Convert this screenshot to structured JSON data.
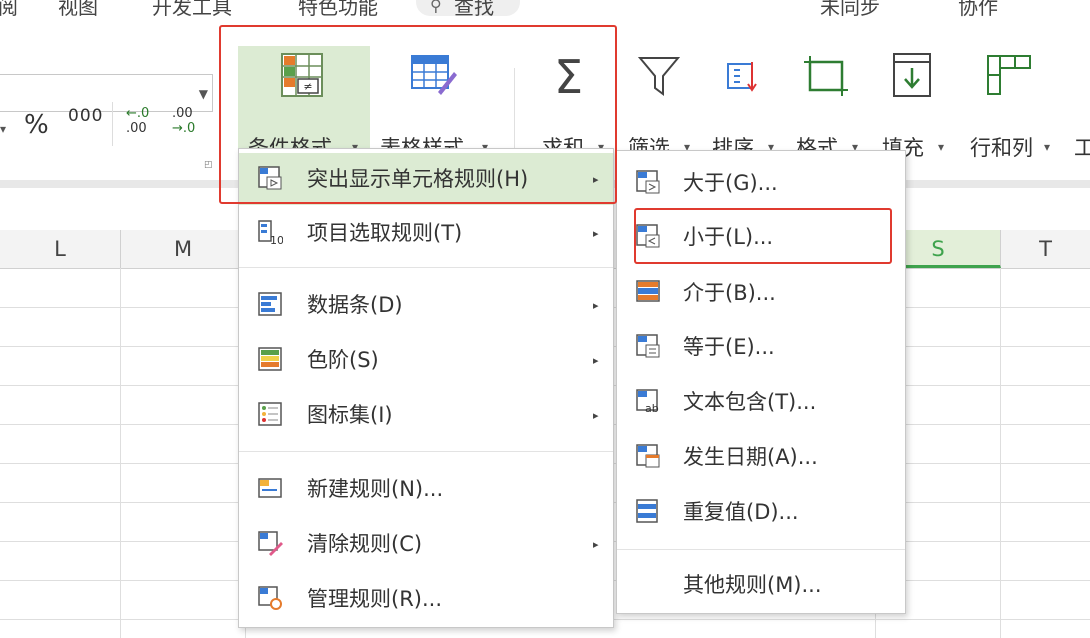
{
  "top_menu": [
    "阅",
    "视图",
    "开发工具",
    "特色功能",
    "查找",
    "未同步",
    "协作"
  ],
  "number_format": {
    "percent": "%",
    "thousands": "000",
    "inc_decimal_top": "←.0",
    "inc_decimal_bottom": ".00",
    "dec_decimal_top": ".00",
    "dec_decimal_bottom": "→.0"
  },
  "ribbon": {
    "conditional_format": "条件格式",
    "table_style": "表格样式",
    "sum": "求和",
    "filter": "筛选",
    "sort": "排序",
    "format": "格式",
    "fill": "填充",
    "rows_cols": "行和列",
    "more": "工"
  },
  "columns": [
    "L",
    "M",
    "S",
    "T"
  ],
  "cf_menu": {
    "items": [
      {
        "label": "突出显示单元格规则(H)",
        "has_submenu": true
      },
      {
        "label": "项目选取规则(T)",
        "has_submenu": true
      },
      {
        "label": "数据条(D)",
        "has_submenu": true
      },
      {
        "label": "色阶(S)",
        "has_submenu": true
      },
      {
        "label": "图标集(I)",
        "has_submenu": true
      },
      {
        "label": "新建规则(N)...",
        "has_submenu": false
      },
      {
        "label": "清除规则(C)",
        "has_submenu": true
      },
      {
        "label": "管理规则(R)...",
        "has_submenu": false
      }
    ]
  },
  "highlight_submenu": {
    "items": [
      {
        "label": "大于(G)..."
      },
      {
        "label": "小于(L)..."
      },
      {
        "label": "介于(B)..."
      },
      {
        "label": "等于(E)..."
      },
      {
        "label": "文本包含(T)..."
      },
      {
        "label": "发生日期(A)..."
      },
      {
        "label": "重复值(D)..."
      },
      {
        "label": "其他规则(M)..."
      }
    ]
  },
  "colors": {
    "accent_green": "#3fa34d",
    "selected_bg": "#dcebd3",
    "highlight_red": "#e03a2f",
    "icon_blue": "#3a7bd5"
  }
}
